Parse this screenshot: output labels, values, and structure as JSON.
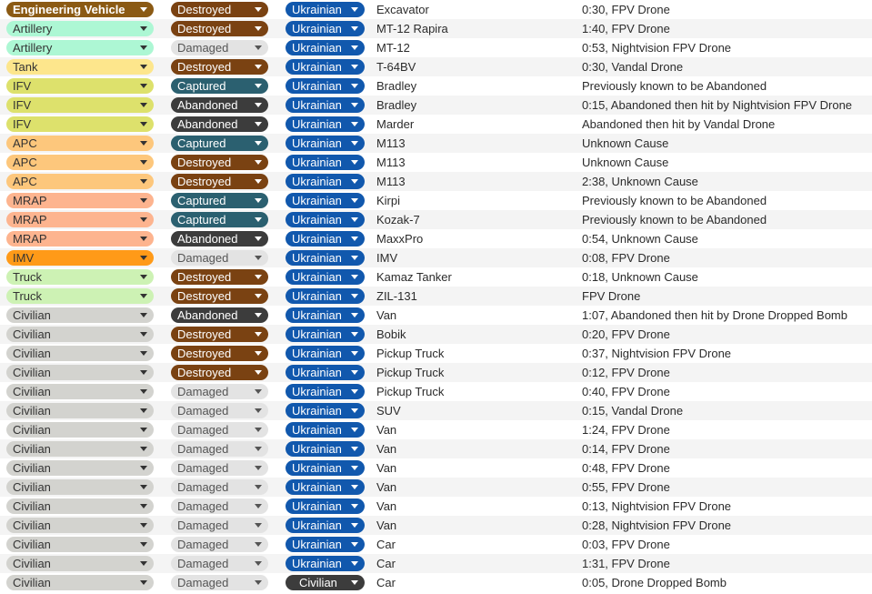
{
  "colors": {
    "type": {
      "Engineering Vehicle": {
        "bg": "#8b5a14",
        "fg": "#ffffff",
        "bold": true
      },
      "Artillery": {
        "bg": "#adf7d4",
        "fg": "#333333"
      },
      "Tank": {
        "bg": "#fde68c",
        "fg": "#333333"
      },
      "IFV": {
        "bg": "#dde16c",
        "fg": "#333333"
      },
      "APC": {
        "bg": "#fdc77c",
        "fg": "#333333"
      },
      "MRAP": {
        "bg": "#fdb48f",
        "fg": "#333333"
      },
      "IMV": {
        "bg": "#ff9a18",
        "fg": "#333333"
      },
      "Truck": {
        "bg": "#cdf2b4",
        "fg": "#333333"
      },
      "Civilian": {
        "bg": "#d3d3cf",
        "fg": "#333333"
      }
    },
    "status": {
      "Destroyed": {
        "bg": "#7a4212",
        "fg": "#ffffff"
      },
      "Damaged": {
        "bg": "#e3e3e3",
        "fg": "#555555"
      },
      "Captured": {
        "bg": "#2b6070",
        "fg": "#ffffff"
      },
      "Abandoned": {
        "bg": "#3c3c3c",
        "fg": "#ffffff"
      }
    },
    "country": {
      "Ukrainian": {
        "bg": "#1158ad",
        "fg": "#ffffff"
      },
      "Civilian": {
        "bg": "#3c3c3c",
        "fg": "#ffffff"
      }
    }
  },
  "icons": {
    "dropdown": "chevron-down-icon"
  },
  "rows": [
    {
      "type": "Engineering Vehicle",
      "status": "Destroyed",
      "country": "Ukrainian",
      "model": "Excavator",
      "cause": "0:30, FPV Drone"
    },
    {
      "type": "Artillery",
      "status": "Destroyed",
      "country": "Ukrainian",
      "model": "MT-12 Rapira",
      "cause": "1:40, FPV Drone"
    },
    {
      "type": "Artillery",
      "status": "Damaged",
      "country": "Ukrainian",
      "model": "MT-12",
      "cause": "0:53, Nightvision FPV Drone"
    },
    {
      "type": "Tank",
      "status": "Destroyed",
      "country": "Ukrainian",
      "model": "T-64BV",
      "cause": "0:30, Vandal Drone"
    },
    {
      "type": "IFV",
      "status": "Captured",
      "country": "Ukrainian",
      "model": "Bradley",
      "cause": "Previously known to be Abandoned"
    },
    {
      "type": "IFV",
      "status": "Abandoned",
      "country": "Ukrainian",
      "model": "Bradley",
      "cause": "0:15, Abandoned then hit by Nightvision FPV Drone"
    },
    {
      "type": "IFV",
      "status": "Abandoned",
      "country": "Ukrainian",
      "model": "Marder",
      "cause": "Abandoned then hit by Vandal Drone"
    },
    {
      "type": "APC",
      "status": "Captured",
      "country": "Ukrainian",
      "model": "M113",
      "cause": "Unknown Cause"
    },
    {
      "type": "APC",
      "status": "Destroyed",
      "country": "Ukrainian",
      "model": "M113",
      "cause": "Unknown Cause"
    },
    {
      "type": "APC",
      "status": "Destroyed",
      "country": "Ukrainian",
      "model": "M113",
      "cause": "2:38, Unknown Cause"
    },
    {
      "type": "MRAP",
      "status": "Captured",
      "country": "Ukrainian",
      "model": "Kirpi",
      "cause": "Previously known to be Abandoned"
    },
    {
      "type": "MRAP",
      "status": "Captured",
      "country": "Ukrainian",
      "model": "Kozak-7",
      "cause": "Previously known to be Abandoned"
    },
    {
      "type": "MRAP",
      "status": "Abandoned",
      "country": "Ukrainian",
      "model": "MaxxPro",
      "cause": "0:54, Unknown Cause"
    },
    {
      "type": "IMV",
      "status": "Damaged",
      "country": "Ukrainian",
      "model": "IMV",
      "cause": "0:08, FPV Drone"
    },
    {
      "type": "Truck",
      "status": "Destroyed",
      "country": "Ukrainian",
      "model": "Kamaz Tanker",
      "cause": "0:18, Unknown Cause"
    },
    {
      "type": "Truck",
      "status": "Destroyed",
      "country": "Ukrainian",
      "model": "ZIL-131",
      "cause": "FPV Drone"
    },
    {
      "type": "Civilian",
      "status": "Abandoned",
      "country": "Ukrainian",
      "model": "Van",
      "cause": "1:07, Abandoned then hit by Drone Dropped Bomb"
    },
    {
      "type": "Civilian",
      "status": "Destroyed",
      "country": "Ukrainian",
      "model": "Bobik",
      "cause": "0:20, FPV Drone"
    },
    {
      "type": "Civilian",
      "status": "Destroyed",
      "country": "Ukrainian",
      "model": "Pickup Truck",
      "cause": "0:37, Nightvision FPV Drone"
    },
    {
      "type": "Civilian",
      "status": "Destroyed",
      "country": "Ukrainian",
      "model": "Pickup Truck",
      "cause": "0:12, FPV Drone"
    },
    {
      "type": "Civilian",
      "status": "Damaged",
      "country": "Ukrainian",
      "model": "Pickup Truck",
      "cause": "0:40, FPV Drone"
    },
    {
      "type": "Civilian",
      "status": "Damaged",
      "country": "Ukrainian",
      "model": "SUV",
      "cause": "0:15, Vandal Drone"
    },
    {
      "type": "Civilian",
      "status": "Damaged",
      "country": "Ukrainian",
      "model": "Van",
      "cause": "1:24, FPV Drone"
    },
    {
      "type": "Civilian",
      "status": "Damaged",
      "country": "Ukrainian",
      "model": "Van",
      "cause": "0:14, FPV Drone"
    },
    {
      "type": "Civilian",
      "status": "Damaged",
      "country": "Ukrainian",
      "model": "Van",
      "cause": "0:48, FPV Drone"
    },
    {
      "type": "Civilian",
      "status": "Damaged",
      "country": "Ukrainian",
      "model": "Van",
      "cause": "0:55, FPV Drone"
    },
    {
      "type": "Civilian",
      "status": "Damaged",
      "country": "Ukrainian",
      "model": "Van",
      "cause": "0:13, Nightvision FPV Drone"
    },
    {
      "type": "Civilian",
      "status": "Damaged",
      "country": "Ukrainian",
      "model": "Van",
      "cause": "0:28, Nightvision FPV Drone"
    },
    {
      "type": "Civilian",
      "status": "Damaged",
      "country": "Ukrainian",
      "model": "Car",
      "cause": "0:03, FPV Drone"
    },
    {
      "type": "Civilian",
      "status": "Damaged",
      "country": "Ukrainian",
      "model": "Car",
      "cause": "1:31, FPV Drone"
    },
    {
      "type": "Civilian",
      "status": "Damaged",
      "country": "Civilian",
      "model": "Car",
      "cause": "0:05, Drone Dropped Bomb"
    }
  ]
}
